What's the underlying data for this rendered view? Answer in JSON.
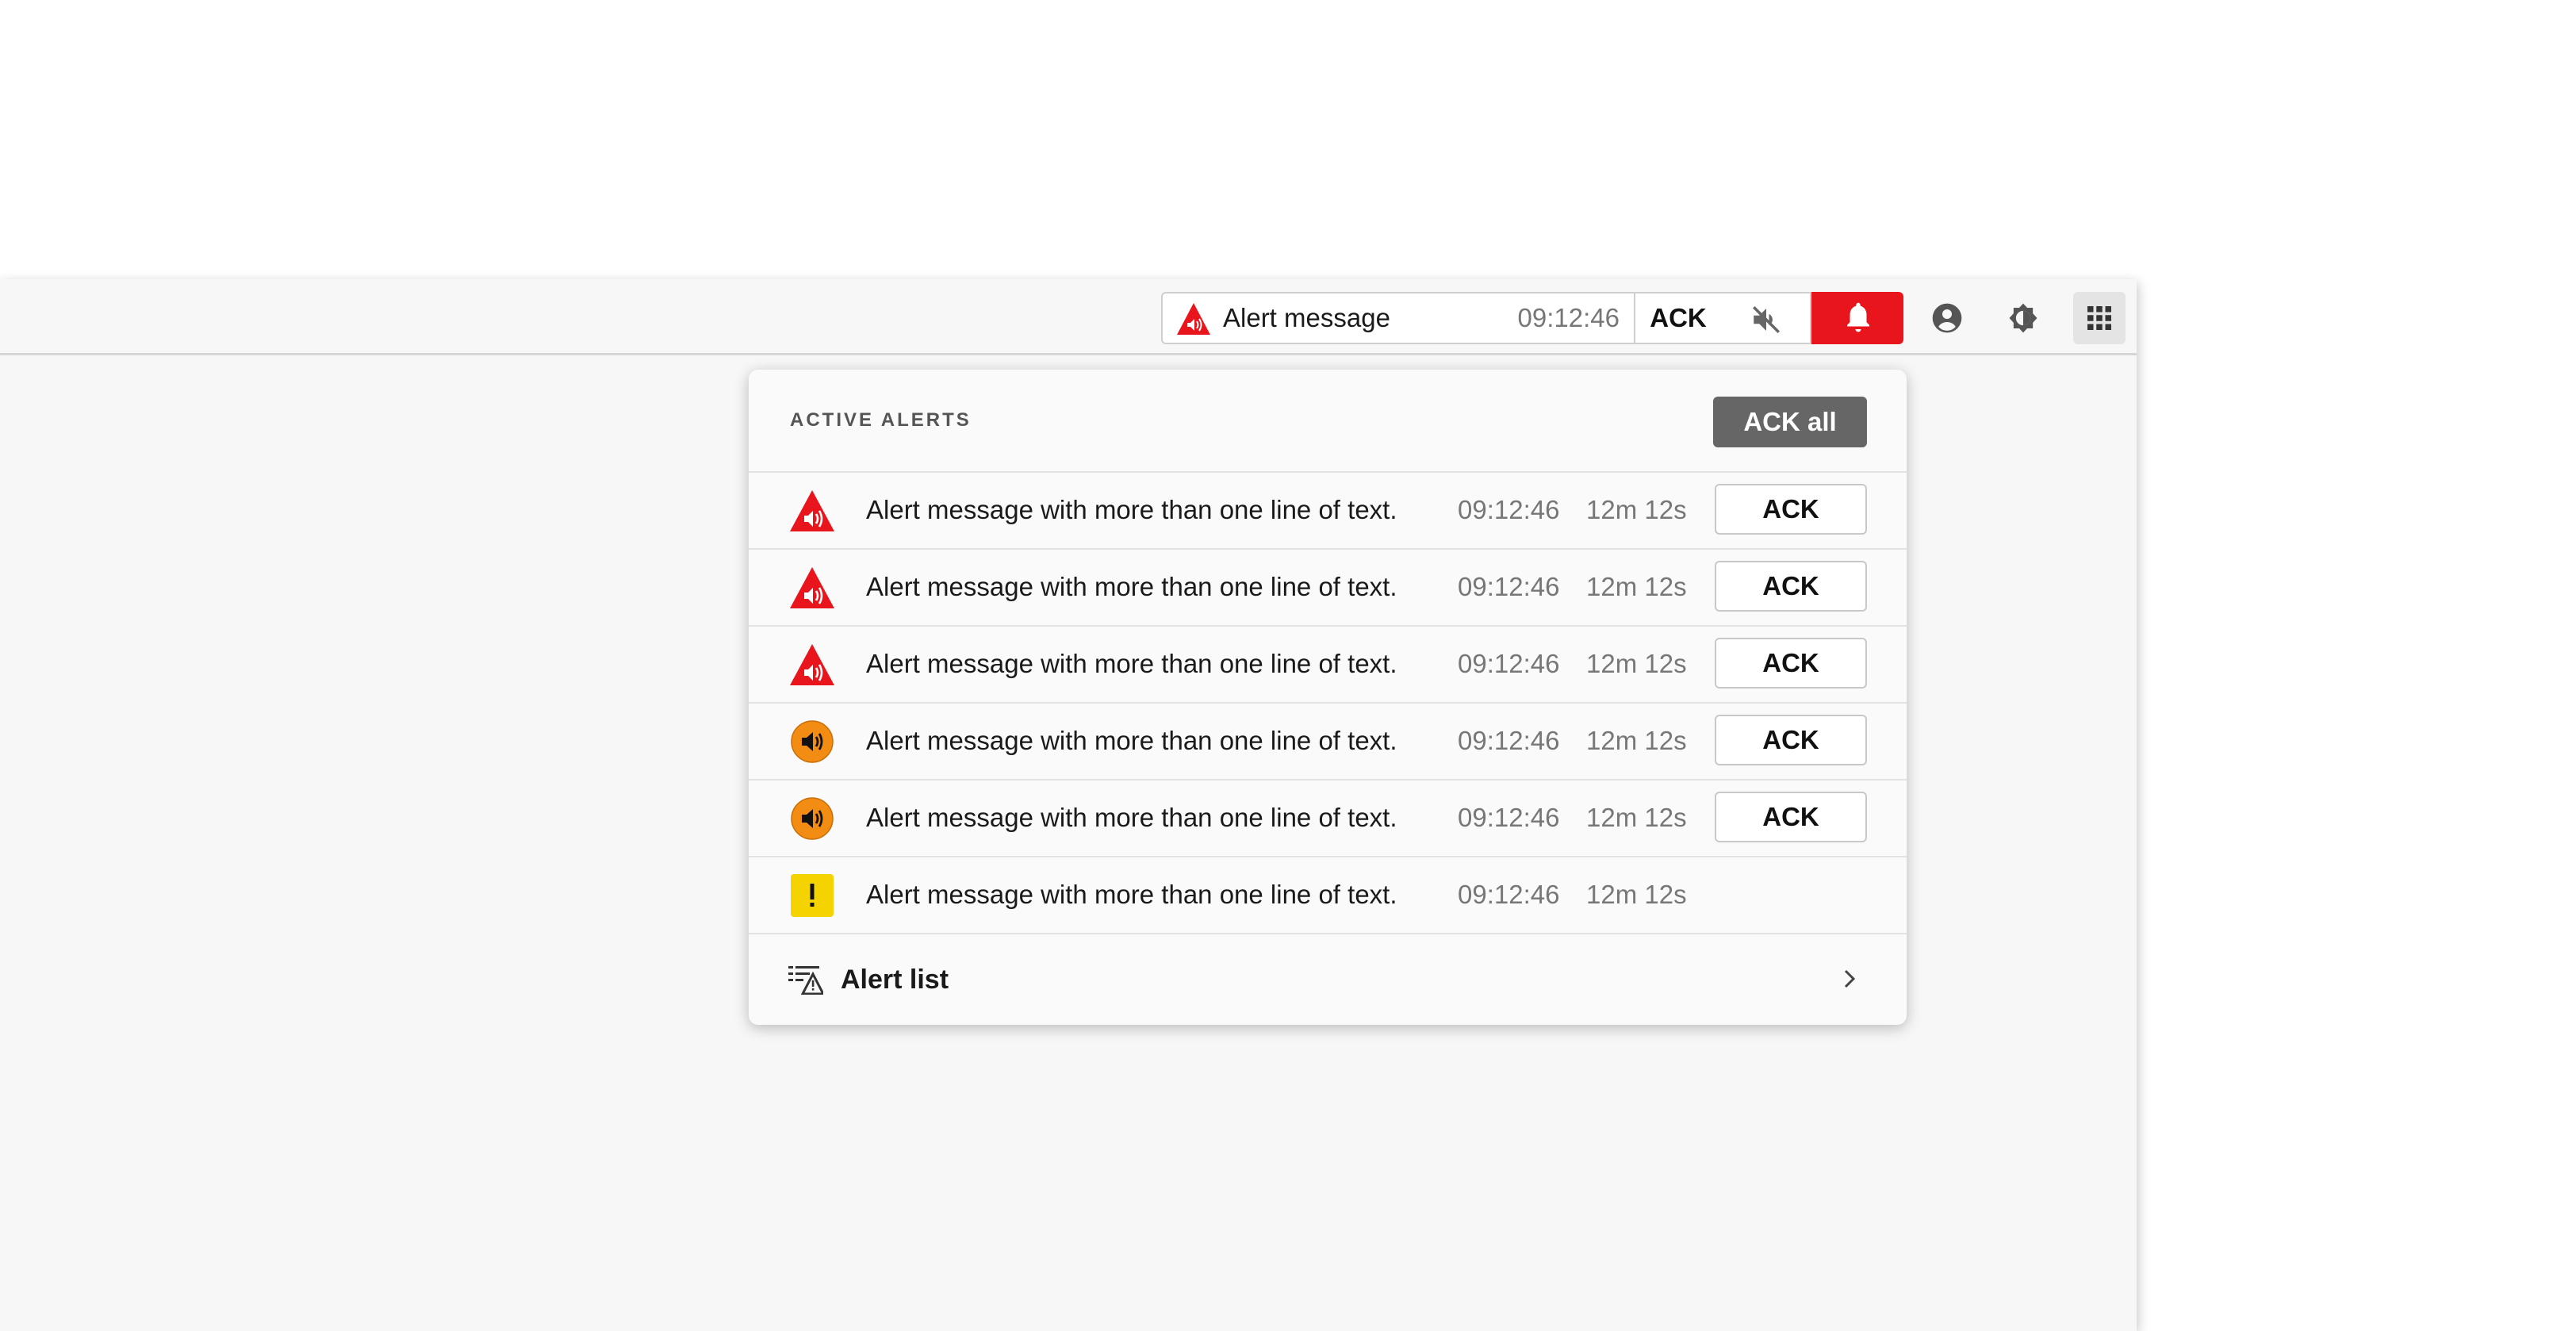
{
  "colors": {
    "alarm": "#e8161c",
    "warning": "#f28c13",
    "caution": "#f5d300",
    "ack_all_bg": "#666666",
    "panel_bg": "#fafafa",
    "window_bg": "#f7f7f7"
  },
  "topbar": {
    "alert": {
      "icon": "alarm-triangle-speaker-icon",
      "message": "Alert message",
      "time": "09:12:46",
      "ack_label": "ACK",
      "mute_icon": "volume-off-icon",
      "bell_icon": "bell-icon"
    },
    "user_icon": "account-circle-icon",
    "theme_icon": "brightness-icon",
    "apps_icon": "apps-grid-icon"
  },
  "panel": {
    "title": "ACTIVE ALERTS",
    "ack_all_label": "ACK all",
    "alerts": [
      {
        "severity": "alarm",
        "icon": "alarm-triangle-speaker-icon",
        "message": "Alert message with more than one line of text.",
        "time": "09:12:46",
        "duration": "12m 12s",
        "ack_label": "ACK"
      },
      {
        "severity": "alarm",
        "icon": "alarm-triangle-speaker-icon",
        "message": "Alert message with more than one line of text.",
        "time": "09:12:46",
        "duration": "12m 12s",
        "ack_label": "ACK"
      },
      {
        "severity": "alarm",
        "icon": "alarm-triangle-speaker-icon",
        "message": "Alert message with more than one line of text.",
        "time": "09:12:46",
        "duration": "12m 12s",
        "ack_label": "ACK"
      },
      {
        "severity": "warning",
        "icon": "warning-circle-speaker-icon",
        "message": "Alert message with more than one line of text.",
        "time": "09:12:46",
        "duration": "12m 12s",
        "ack_label": "ACK"
      },
      {
        "severity": "warning",
        "icon": "warning-circle-speaker-icon",
        "message": "Alert message with more than one line of text.",
        "time": "09:12:46",
        "duration": "12m 12s",
        "ack_label": "ACK"
      },
      {
        "severity": "caution",
        "icon": "caution-square-exclamation-icon",
        "message": "Alert message with more than one line of text.",
        "time": "09:12:46",
        "duration": "12m 12s",
        "ack_label": ""
      }
    ],
    "footer": {
      "icon": "alert-list-icon",
      "label": "Alert list",
      "chevron_icon": "chevron-right-icon"
    }
  }
}
